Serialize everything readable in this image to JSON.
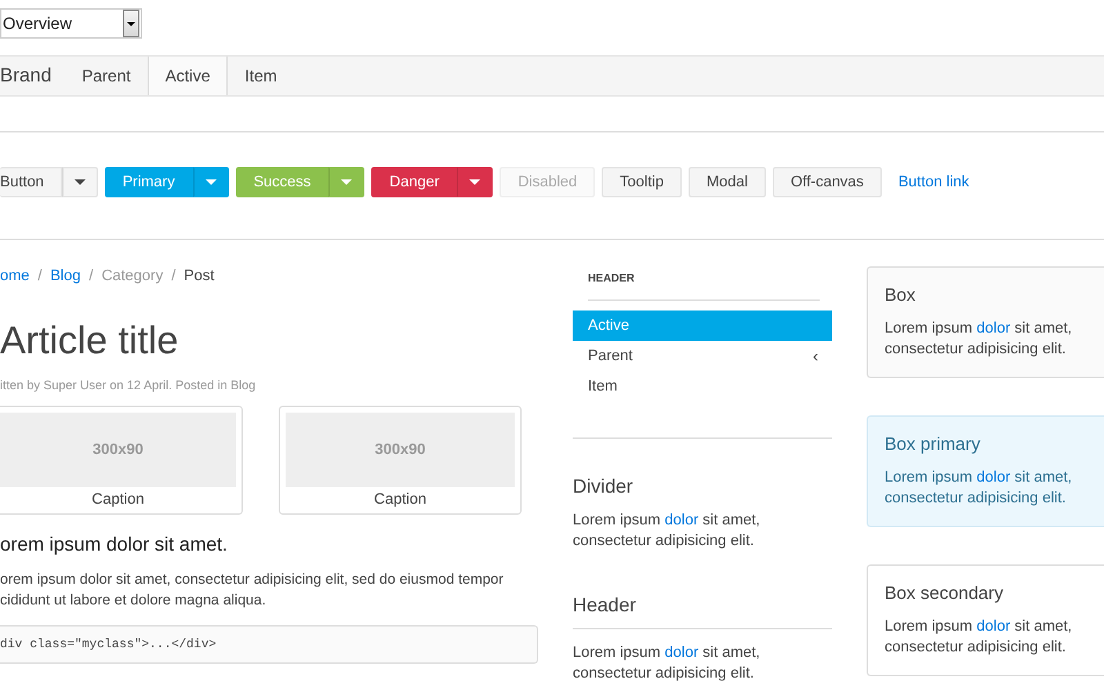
{
  "select": {
    "value": "Overview"
  },
  "navbar": {
    "brand": "Brand",
    "items": [
      {
        "label": "Parent",
        "selected": false
      },
      {
        "label": "Active",
        "selected": true
      },
      {
        "label": "Item",
        "selected": false
      }
    ]
  },
  "buttons": [
    {
      "kind": "split",
      "label": "Button",
      "disabled": false
    },
    {
      "kind": "primary",
      "label": "Primary",
      "disabled": false
    },
    {
      "kind": "success",
      "label": "Success",
      "disabled": false
    },
    {
      "kind": "danger",
      "label": "Danger",
      "disabled": false
    },
    {
      "kind": "plain",
      "label": "Disabled",
      "disabled": true
    },
    {
      "kind": "plain",
      "label": "Tooltip",
      "disabled": false
    },
    {
      "kind": "plain",
      "label": "Modal",
      "disabled": false
    },
    {
      "kind": "plain",
      "label": "Off-canvas",
      "disabled": false
    },
    {
      "kind": "link",
      "label": "Button link",
      "disabled": false
    }
  ],
  "breadcrumb": [
    {
      "label": "ome",
      "kind": "link"
    },
    {
      "label": "/",
      "kind": "separator"
    },
    {
      "label": "Blog",
      "kind": "link"
    },
    {
      "label": "/",
      "kind": "separator"
    },
    {
      "label": "Category",
      "kind": "muted"
    },
    {
      "label": "/",
      "kind": "separator"
    },
    {
      "label": "Post",
      "kind": "current"
    }
  ],
  "article": {
    "title": "Article title",
    "meta": "itten by Super User on 12 April. Posted in Blog",
    "thumbnails": [
      {
        "size_label": "300x90",
        "caption": "Caption"
      },
      {
        "size_label": "300x90",
        "caption": "Caption"
      }
    ],
    "lead": "orem ipsum dolor sit amet.",
    "paragraph_lines": [
      "orem ipsum dolor sit amet, consectetur adipisicing elit, sed do eiusmod tempor",
      "cididunt ut labore et dolore magna aliqua."
    ],
    "code": "div class=\"myclass\">...</div>"
  },
  "nav": {
    "header": "HEADER",
    "items": [
      {
        "label": "Active",
        "selected": true
      },
      {
        "label": "Parent",
        "selected": false,
        "chevron": "‹"
      },
      {
        "label": "Item",
        "selected": false
      }
    ]
  },
  "panels": [
    {
      "kind": "divider",
      "title": "Divider",
      "before": "Lorem ipsum",
      "link": "dolor",
      "after": "sit amet, consectetur adipisicing elit."
    },
    {
      "kind": "header",
      "title": "Header",
      "before": "Lorem ipsum",
      "link": "dolor",
      "after": "sit amet, consectetur adipisicing elit."
    }
  ],
  "boxes": [
    {
      "kind": "plain",
      "title": "Box",
      "before": "Lorem ipsum",
      "link": "dolor",
      "after": "sit amet, consectetur adipisicing elit."
    },
    {
      "kind": "primary",
      "title": "Box primary",
      "before": "Lorem ipsum",
      "link": "dolor",
      "after": "sit amet, consectetur adipisicing elit."
    },
    {
      "kind": "secondary",
      "title": "Box secondary",
      "before": "Lorem ipsum",
      "link": "dolor",
      "after": "sit amet, consectetur adipisicing elit."
    }
  ]
}
